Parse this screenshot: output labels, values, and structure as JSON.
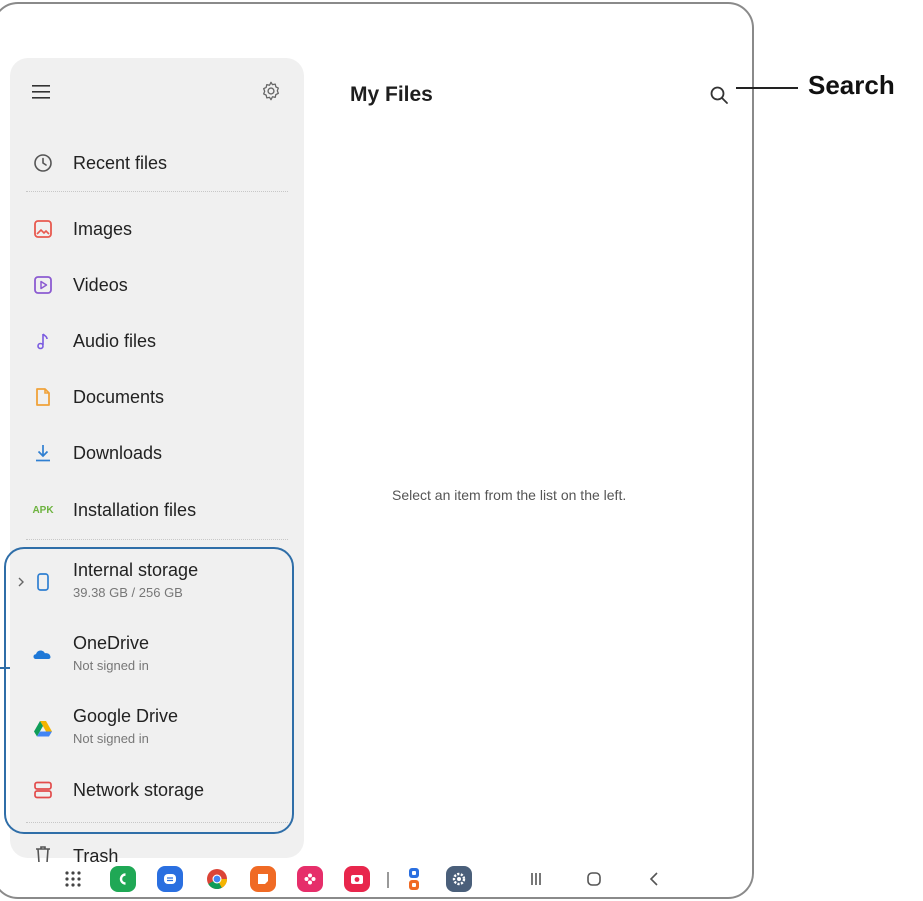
{
  "app": {
    "title": "My Files"
  },
  "drawer": {
    "items": [
      {
        "label": "Recent files",
        "icon": "clock-icon"
      },
      {
        "label": "Images",
        "icon": "image-icon"
      },
      {
        "label": "Videos",
        "icon": "video-icon"
      },
      {
        "label": "Audio files",
        "icon": "music-note-icon"
      },
      {
        "label": "Documents",
        "icon": "document-icon"
      },
      {
        "label": "Downloads",
        "icon": "download-icon"
      },
      {
        "label": "Installation files",
        "icon": "apk-icon",
        "icon_text": "APK"
      }
    ],
    "storage": [
      {
        "label": "Internal storage",
        "sub": "39.38 GB / 256 GB",
        "icon": "phone-icon"
      },
      {
        "label": "OneDrive",
        "sub": "Not signed in",
        "icon": "onedrive-icon"
      },
      {
        "label": "Google Drive",
        "sub": "Not signed in",
        "icon": "google-drive-icon"
      },
      {
        "label": "Network storage",
        "icon": "network-storage-icon"
      }
    ],
    "trash_label": "Trash"
  },
  "main": {
    "empty_message": "Select an item from the list on the left."
  },
  "callout": {
    "search_label": "Search"
  },
  "colors": {
    "accent": "#2f6ea8",
    "images": "#e8594f",
    "videos": "#8c5bd1",
    "audio": "#7a5be0",
    "documents": "#f0a23a",
    "downloads": "#2f7fd1",
    "apk": "#6db33f",
    "network": "#e24b4b"
  },
  "taskbar": {
    "apps": [
      "apps-grid-icon",
      "phone-app-icon",
      "messages-app-icon",
      "chrome-app-icon",
      "notes-app-icon",
      "flower-app-icon",
      "camera-app-icon",
      "galaxy-store-icon",
      "settings-app-icon"
    ],
    "nav": [
      "recents-icon",
      "home-icon",
      "back-icon"
    ]
  }
}
